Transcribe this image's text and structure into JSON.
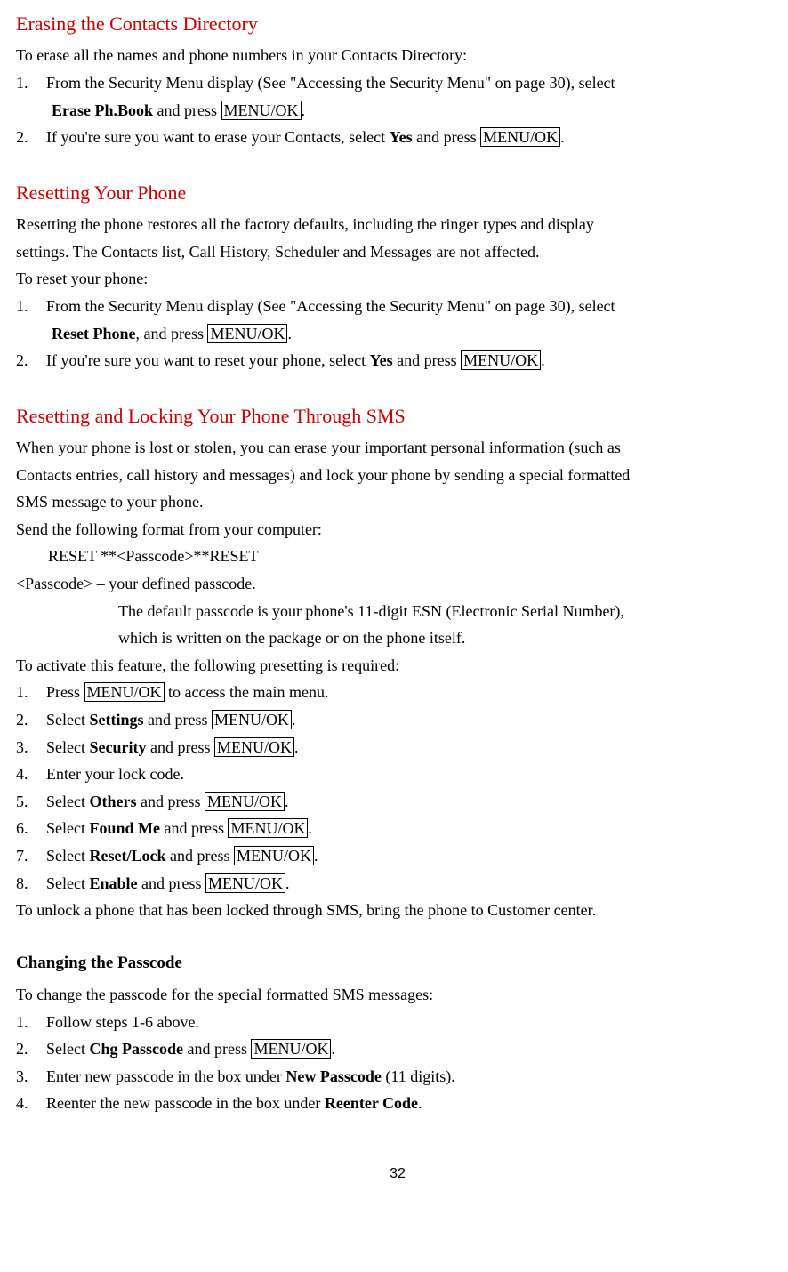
{
  "s1": {
    "title": "Erasing the Contacts Directory",
    "intro": "To erase all the names and phone numbers in your Contacts Directory:",
    "i1_a": "From the Security Menu display (See \"Accessing the Security Menu\" on page 30), select",
    "i1_b_bold": "Erase Ph.Book",
    "i1_b_mid": " and press ",
    "i1_b_key": "MENU/OK",
    "i2_a": "If you're sure you want to erase your Contacts, select ",
    "i2_bold": "Yes",
    "i2_mid": " and press ",
    "i2_key": "MENU/OK"
  },
  "s2": {
    "title": "Resetting Your Phone",
    "intro1": "Resetting the phone restores all the factory defaults, including the ringer types and display",
    "intro2": "settings. The Contacts list, Call History, Scheduler and Messages are not affected.",
    "intro3": "To reset your phone:",
    "i1_a": "From the Security Menu display (See \"Accessing the Security Menu\" on page 30), select",
    "i1_b_bold": "Reset Phone",
    "i1_b_mid": ", and press ",
    "i1_b_key": "MENU/OK",
    "i2_a": "If you're sure you want to reset your phone, select ",
    "i2_bold": "Yes",
    "i2_mid": " and press ",
    "i2_key": "MENU/OK"
  },
  "s3": {
    "title": "Resetting and Locking Your Phone Through SMS",
    "intro1": "When your phone is lost or stolen, you can erase your important personal information (such as",
    "intro2": "Contacts entries, call history and messages) and lock your phone by sending a special formatted",
    "intro3": "SMS message to your phone.",
    "send": "Send the following format from your computer:",
    "format": "　　RESET **<Passcode>**RESET",
    "pass1": "<Passcode> – your defined passcode.",
    "pass2": "The default passcode is your phone's 11-digit ESN (Electronic Serial Number),",
    "pass3": "which is written on the package or on the phone itself.",
    "activate": "To activate this feature, the following presetting is required:",
    "i1_a": "Press ",
    "i1_key": "MENU/OK",
    "i1_b": " to access the main menu.",
    "i2_a": "Select ",
    "i2_bold": "Settings",
    "i2_mid": " and press ",
    "i2_key": "MENU/OK",
    "i3_a": "Select ",
    "i3_bold": "Security",
    "i3_mid": " and press ",
    "i3_key": "MENU/OK",
    "i4": "Enter your lock code.",
    "i5_a": "Select ",
    "i5_bold": "Others",
    "i5_mid": " and press ",
    "i5_key": "MENU/OK",
    "i6_a": "Select ",
    "i6_bold": "Found Me",
    "i6_mid": " and press ",
    "i6_key": "MENU/OK",
    "i7_a": "Select ",
    "i7_bold": "Reset/Lock",
    "i7_mid": " and press ",
    "i7_key": "MENU/OK",
    "i8_a": "Select ",
    "i8_bold": "Enable",
    "i8_mid": " and press ",
    "i8_key": "MENU/OK",
    "unlock": "To unlock a phone that has been locked through SMS, bring the phone to Customer center."
  },
  "s4": {
    "title": "Changing the Passcode",
    "intro": "To change the passcode for the special formatted SMS messages:",
    "i1": "Follow steps 1-6 above.",
    "i2_a": "Select ",
    "i2_bold": "Chg Passcode",
    "i2_mid": " and press ",
    "i2_key": "MENU/OK",
    "i3_a": "Enter new passcode in the box under ",
    "i3_bold": "New Passcode",
    "i3_b": " (11 digits).",
    "i4_a": "Reenter the new passcode in the box under ",
    "i4_bold": "Reenter Code"
  },
  "page": "32",
  "nums": {
    "n1": "1.",
    "n2": "2.",
    "n3": "3.",
    "n4": "4.",
    "n5": "5.",
    "n6": "6.",
    "n7": "7.",
    "n8": "8."
  },
  "dot": "."
}
